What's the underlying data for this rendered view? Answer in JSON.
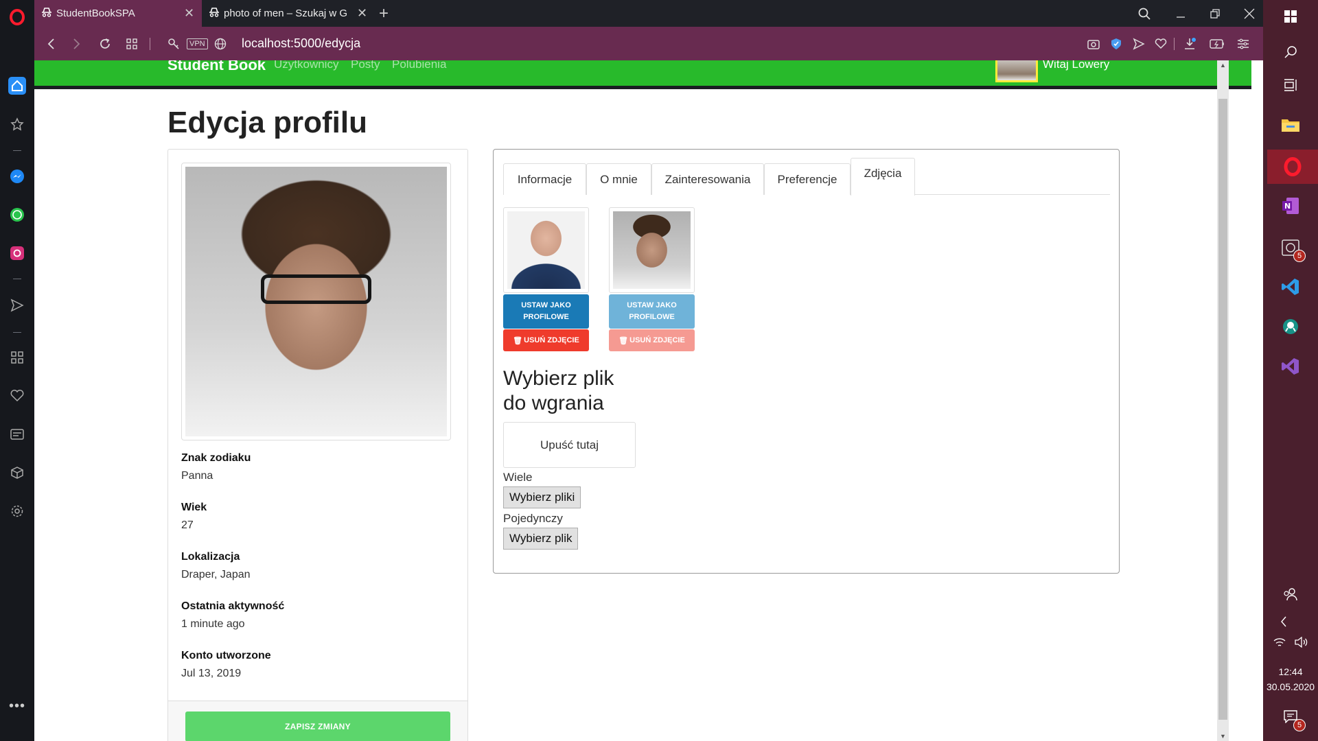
{
  "browser": {
    "tabs": [
      {
        "label": "StudentBookSPA",
        "active": true
      },
      {
        "label": "photo of men – Szukaj w G",
        "active": false
      }
    ],
    "url": "localhost:5000/edycja",
    "vpn_label": "VPN"
  },
  "navbar": {
    "brand": "Student Book",
    "links": [
      "Użytkownicy",
      "Posty",
      "Polubienia"
    ],
    "greeting": "Witaj Lowery"
  },
  "page": {
    "title": "Edycja profilu"
  },
  "profile": {
    "details": [
      {
        "label": "Znak zodiaku",
        "value": "Panna"
      },
      {
        "label": "Wiek",
        "value": "27"
      },
      {
        "label": "Lokalizacja",
        "value": "Draper, Japan"
      },
      {
        "label": "Ostatnia aktywność",
        "value": "1 minute ago"
      },
      {
        "label": "Konto utworzone",
        "value": "Jul 13, 2019"
      }
    ],
    "save_button": "ZAPISZ ZMIANY"
  },
  "tabs": {
    "items": [
      "Informacje",
      "O mnie",
      "Zainteresowania",
      "Preferencje",
      "Zdjęcia"
    ],
    "active": "Zdjęcia"
  },
  "photos": [
    {
      "set_label": "USTAW JAKO PROFILOWE",
      "delete_label": "USUŃ ZDJĘCIE",
      "is_main": false
    },
    {
      "set_label": "USTAW JAKO PROFILOWE",
      "delete_label": "USUŃ ZDJĘCIE",
      "is_main": true
    }
  ],
  "upload": {
    "title": "Wybierz plik do wgrania",
    "dropzone": "Upuść tutaj",
    "multiple_label": "Wiele",
    "multiple_button": "Wybierz pliki",
    "single_label": "Pojedynczy",
    "single_button": "Wybierz plik"
  },
  "taskbar": {
    "time": "12:44",
    "date": "30.05.2020",
    "badges": {
      "timer": "5",
      "notifications": "5"
    }
  },
  "colors": {
    "navbar_green": "#28ba2b",
    "primary_blue": "#1a7ab6",
    "primary_blue_disabled": "#6fb3d9",
    "danger_red": "#ef3b2c",
    "danger_red_disabled": "#f59a92",
    "success_green": "#5cd66c",
    "addressbar": "#682b50"
  },
  "icons": [
    "opera-logo-icon",
    "home-icon",
    "star-icon",
    "messenger-icon",
    "whatsapp-icon",
    "instagram-icon",
    "send-icon",
    "grid-icon",
    "heart-icon",
    "news-icon",
    "cube-icon",
    "settings-icon",
    "more-icon"
  ]
}
